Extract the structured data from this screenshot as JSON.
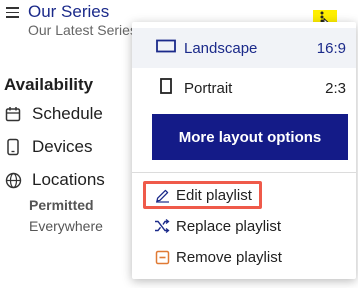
{
  "series": {
    "title": "Our Series",
    "subtitle": "Our Latest Series"
  },
  "sidebar": {
    "heading": "Availability",
    "items": [
      {
        "label": "Schedule",
        "icon": "calendar-icon"
      },
      {
        "label": "Devices",
        "icon": "device-icon"
      },
      {
        "label": "Locations",
        "icon": "globe-icon"
      }
    ],
    "permitted_label": "Permitted",
    "permitted_value": "Everywhere"
  },
  "menu": {
    "trigger_icon": "more-options-icon",
    "layouts": [
      {
        "label": "Landscape",
        "ratio": "16:9",
        "selected": true,
        "icon": "landscape-icon"
      },
      {
        "label": "Portrait",
        "ratio": "2:3",
        "selected": false,
        "icon": "portrait-icon"
      }
    ],
    "more_button": "More layout options",
    "actions": [
      {
        "label": "Edit playlist",
        "icon": "edit-icon"
      },
      {
        "label": "Replace playlist",
        "icon": "shuffle-icon"
      },
      {
        "label": "Remove playlist",
        "icon": "remove-icon"
      }
    ]
  },
  "colors": {
    "accent": "#1b2a8a",
    "button_bg": "#141b88",
    "trigger_highlight": "#ffef00",
    "callout": "#ef5a4a",
    "remove_icon": "#e07a35"
  }
}
